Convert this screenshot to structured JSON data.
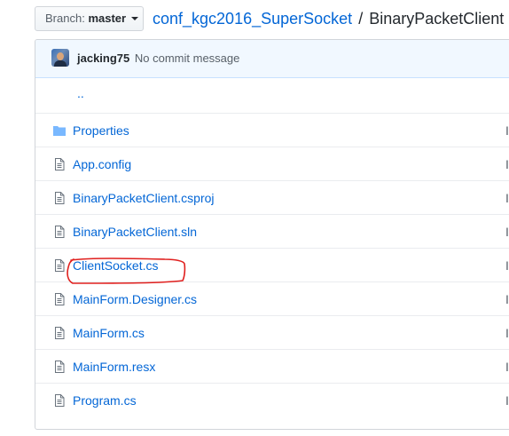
{
  "branch": {
    "prefix": "Branch:",
    "name": "master"
  },
  "breadcrumb": {
    "repo": "conf_kgc2016_SuperSocket",
    "separator": "/",
    "folder": "BinaryPacketClient",
    "trailing": "/"
  },
  "commit": {
    "author": "jacking75",
    "message": "No commit message"
  },
  "files": {
    "parent": "..",
    "cutoff_char": "I",
    "items": [
      {
        "name": "Properties",
        "type": "folder"
      },
      {
        "name": "App.config",
        "type": "file"
      },
      {
        "name": "BinaryPacketClient.csproj",
        "type": "file"
      },
      {
        "name": "BinaryPacketClient.sln",
        "type": "file"
      },
      {
        "name": "ClientSocket.cs",
        "type": "file"
      },
      {
        "name": "MainForm.Designer.cs",
        "type": "file"
      },
      {
        "name": "MainForm.cs",
        "type": "file"
      },
      {
        "name": "MainForm.resx",
        "type": "file"
      },
      {
        "name": "Program.cs",
        "type": "file"
      }
    ]
  },
  "colors": {
    "link": "#0366d6",
    "annotation": "#e0201e",
    "commit_bar": "#f1f8ff"
  }
}
